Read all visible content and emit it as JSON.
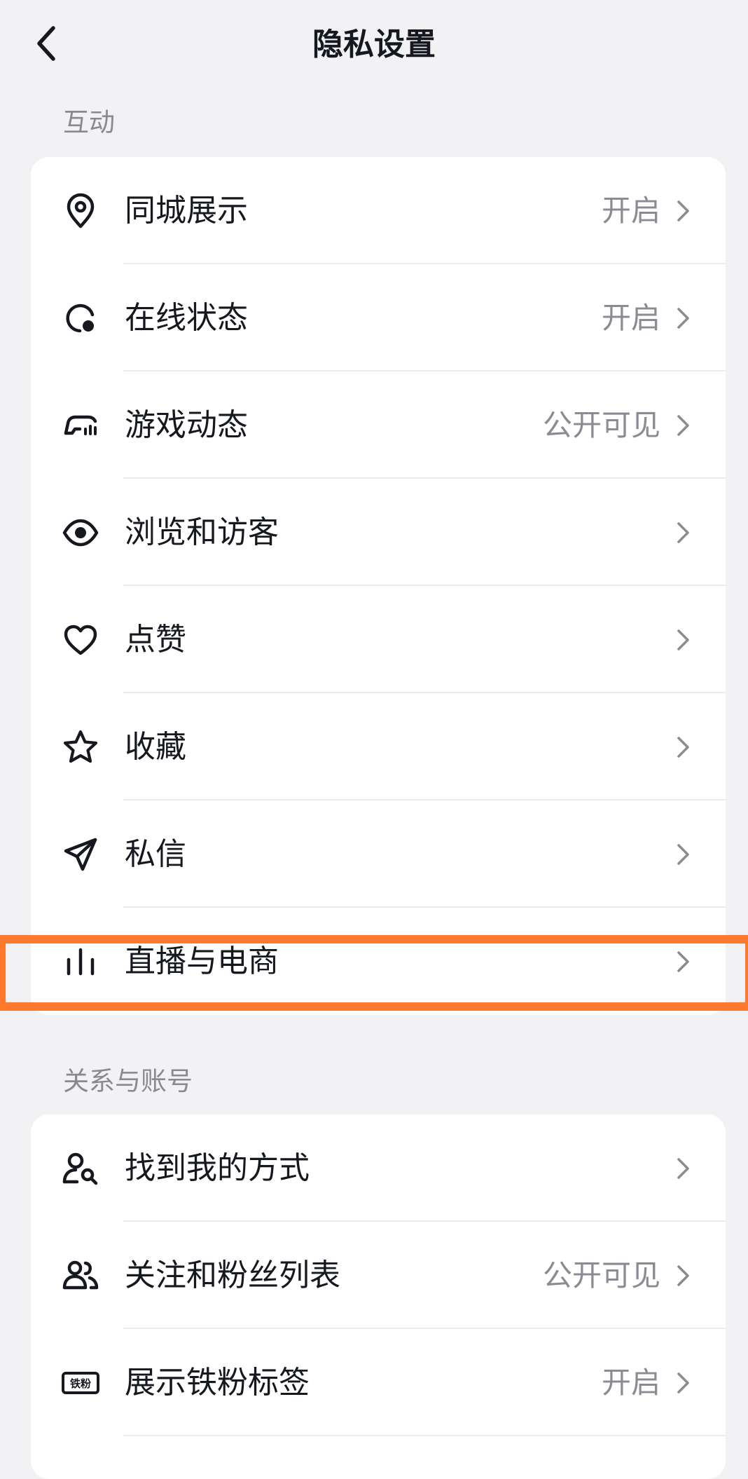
{
  "header": {
    "title": "隐私设置"
  },
  "sections": [
    {
      "label": "互动",
      "items": [
        {
          "label": "同城展示",
          "value": "开启",
          "icon": "location-pin-icon"
        },
        {
          "label": "在线状态",
          "value": "开启",
          "icon": "online-status-icon"
        },
        {
          "label": "游戏动态",
          "value": "公开可见",
          "icon": "gamepad-icon"
        },
        {
          "label": "浏览和访客",
          "value": "",
          "icon": "eye-icon"
        },
        {
          "label": "点赞",
          "value": "",
          "icon": "heart-icon"
        },
        {
          "label": "收藏",
          "value": "",
          "icon": "star-icon"
        },
        {
          "label": "私信",
          "value": "",
          "icon": "paper-plane-icon"
        },
        {
          "label": "直播与电商",
          "value": "",
          "icon": "live-bars-icon"
        }
      ]
    },
    {
      "label": "关系与账号",
      "items": [
        {
          "label": "找到我的方式",
          "value": "",
          "icon": "person-search-icon"
        },
        {
          "label": "关注和粉丝列表",
          "value": "公开可见",
          "icon": "users-icon"
        },
        {
          "label": "展示铁粉标签",
          "value": "开启",
          "icon": "fan-badge-icon",
          "icon_text": "铁粉"
        }
      ]
    }
  ],
  "highlight": {
    "color": "#ff7a2f"
  }
}
